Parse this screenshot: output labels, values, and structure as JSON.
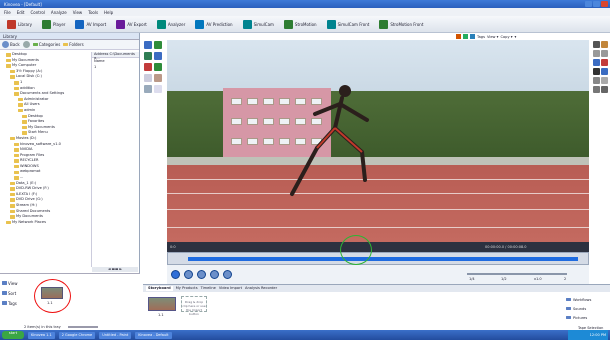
{
  "window": {
    "title": "Kinovea - [Default]"
  },
  "menu": [
    "File",
    "Edit",
    "Control",
    "Analyze",
    "View",
    "Tools",
    "Help"
  ],
  "toolbar": [
    {
      "label": "Library",
      "icon": "library-icon",
      "color": "#c0392b"
    },
    {
      "label": "Player",
      "icon": "player-icon",
      "color": "#2e7d32"
    },
    {
      "label": "AV Import",
      "icon": "import-icon",
      "color": "#1565c0"
    },
    {
      "label": "AV Export",
      "icon": "export-icon",
      "color": "#6a1b9a"
    },
    {
      "label": "Analyzer",
      "icon": "analyzer-icon",
      "color": "#00897b"
    },
    {
      "label": "AV Prediction",
      "icon": "prediction-icon",
      "color": "#0277bd"
    },
    {
      "label": "SimulCam",
      "icon": "simulcam-icon",
      "color": "#00838f"
    },
    {
      "label": "StroMotion",
      "icon": "stromotion-icon",
      "color": "#2e7d32"
    },
    {
      "label": "SimulCam Front",
      "icon": "simulcam-front-icon",
      "color": "#00838f"
    },
    {
      "label": "StroMotion Front",
      "icon": "stromotion-front-icon",
      "color": "#2e7d32"
    }
  ],
  "library": {
    "title": "Library",
    "nav": {
      "back": "Back",
      "categories": "Categories",
      "folders": "Folders"
    },
    "tree": [
      "Desktop",
      "My Documents",
      "My Computer",
      "3½ Floppy (A:)",
      "Local Disk (C:)",
      "1",
      "addition",
      "Documents and Settings",
      "Administrator",
      "All Users",
      "admin",
      "Desktop",
      "Favorites",
      "My Documents",
      "Start Menu",
      "Movies (D:)",
      "kinovea_software_v1.0",
      "NVIDIA",
      "Program Files",
      "RECYCLER",
      "WINDOWS",
      "webpromot",
      "...",
      "Data_1 (E:)",
      "DVD-RW Drive (F:)",
      "ILEXTA I (F:)",
      "DVD Drive (G:)",
      "Stream (H:)",
      "Shared Documents",
      "My Documents",
      "My Network Places"
    ],
    "address_label": "Address",
    "address_value": "C:\\Documents a...",
    "name_col": "Name",
    "name_val": "1",
    "hscroll": "◄ ▬▬ ►",
    "side": [
      {
        "label": "View",
        "icon": "view-icon"
      },
      {
        "label": "Sort",
        "icon": "sort-icon"
      },
      {
        "label": "Tags",
        "icon": "tags-icon"
      }
    ],
    "thumb_label": "1.1",
    "footer": "2 item(s) in this tray"
  },
  "viewer": {
    "top_label": "Tags",
    "top_items": [
      "View ▾",
      "Copy ▾",
      "▾"
    ]
  },
  "timeline": {
    "left": "0:0",
    "right": "00:00:00.0 / 00:00:08.0"
  },
  "controls": {
    "labels": [
      "1/4",
      "1/2",
      "x1.0",
      "2"
    ]
  },
  "storyboard": {
    "tabs": [
      "Storyboard",
      "My Products",
      "Timeline",
      "Video Import",
      "Analysis Recorder"
    ],
    "placeholder": "Drag & drop clip here or use the Import button",
    "thumb_label": "1.1",
    "side": [
      {
        "label": "Workflows",
        "icon": "workflow-icon"
      },
      {
        "label": "Sounds",
        "icon": "sounds-icon"
      },
      {
        "label": "Pictures",
        "icon": "pictures-icon"
      }
    ],
    "status": "Tape Selection"
  },
  "taskbar": {
    "start": "start",
    "tasks": [
      "Kinovea 1.1",
      "2 Google Chrome",
      "Untitled - Paint",
      "Kinovea - Default"
    ],
    "clock": "12:00 PM"
  }
}
